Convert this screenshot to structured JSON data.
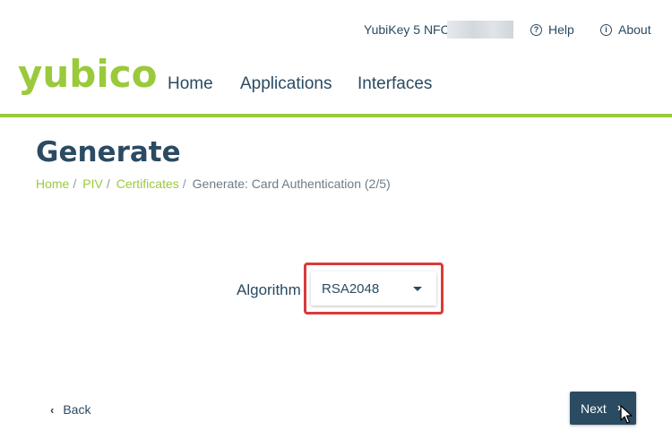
{
  "topbar": {
    "device_name": "YubiKey 5 NFC",
    "help_label": "Help",
    "about_label": "About",
    "help_icon": "question-circle-icon",
    "about_icon": "info-circle-icon"
  },
  "header": {
    "logo_text": "yubico",
    "nav": {
      "home": "Home",
      "applications": "Applications",
      "interfaces": "Interfaces"
    }
  },
  "page": {
    "title": "Generate",
    "breadcrumb": {
      "items": [
        "Home",
        "PIV",
        "Certificates"
      ],
      "separator": "/",
      "current": "Generate: Card Authentication (2/5)"
    }
  },
  "form": {
    "algorithm_label": "Algorithm",
    "algorithm_value": "RSA2048"
  },
  "footer": {
    "back_label": "Back",
    "next_label": "Next"
  },
  "colors": {
    "brand_green": "#9aca3c",
    "text_navy": "#2a4b62",
    "highlight_red": "#d93a3a"
  }
}
